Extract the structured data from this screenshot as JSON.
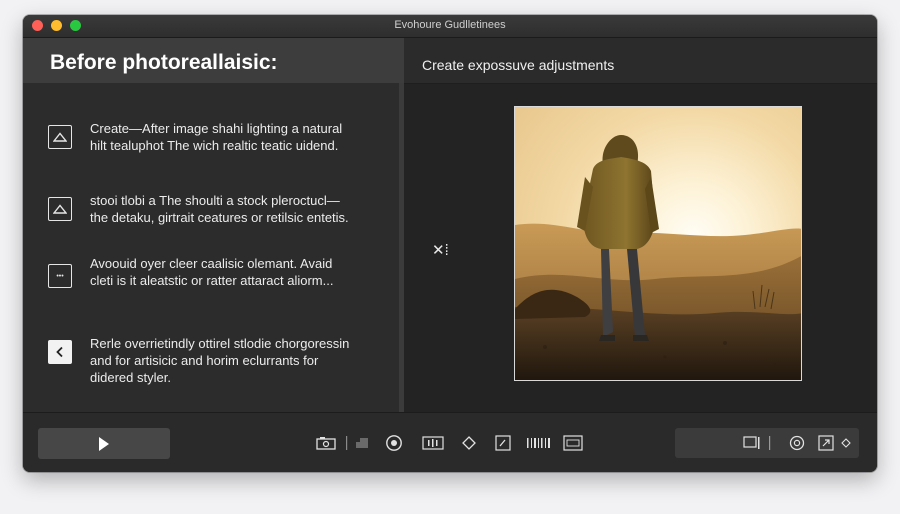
{
  "window": {
    "title": "Evohoure Gudlletinees"
  },
  "left_panel": {
    "title": "Before photoreallaisic:",
    "items": [
      {
        "icon": "triangle-up-icon",
        "lines": [
          "Create—After image shahi lighting a natural",
          "hilt tealuphot The wich realtic teatic uidend."
        ]
      },
      {
        "icon": "triangle-up-icon",
        "lines": [
          "stooi tlobi a The shoulti a stock pleroctucl—",
          "the detaku, girtrait ceatures or retilsic entetis."
        ]
      },
      {
        "icon": "frame-icon",
        "icon_text": "•••",
        "lines": [
          "Avoouid oyer cleer caalisic olemant. Avaid",
          "cleti is it aleatstic or ratter attaract aliorm..."
        ]
      },
      {
        "icon": "chevron-left-icon",
        "lines": [
          "Rerle overrietindly ottirel stlodie chorgoressin",
          "and for artisicic and horim eclurrants for",
          "didered styler."
        ]
      }
    ]
  },
  "right_panel": {
    "title": "Create expossuve adjustments",
    "close_label": "✕⁞"
  },
  "colors": {
    "window_bg": "#262626",
    "panel_header": "#3d3d3d",
    "traffic_red": "#fe5f57",
    "traffic_yellow": "#febc2e",
    "traffic_green": "#28c840"
  }
}
